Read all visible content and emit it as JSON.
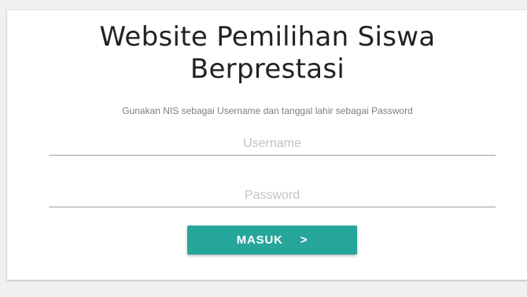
{
  "login": {
    "title_line1": "Website Pemilihan Siswa",
    "title_line2": "Berprestasi",
    "instructions": "Gunakan NIS sebagai Username dan tanggal lahir sebagai Password",
    "username_placeholder": "Username",
    "username_value": "",
    "password_placeholder": "Password",
    "password_value": "",
    "submit_label": "MASUK",
    "submit_icon": "chevron-right-icon",
    "submit_icon_glyph": ">"
  },
  "colors": {
    "page_background": "#f0f0f0",
    "card_background": "#ffffff",
    "button_accent": "#26a69a",
    "title_text": "#222222",
    "placeholder_text": "#c2c2c2"
  }
}
